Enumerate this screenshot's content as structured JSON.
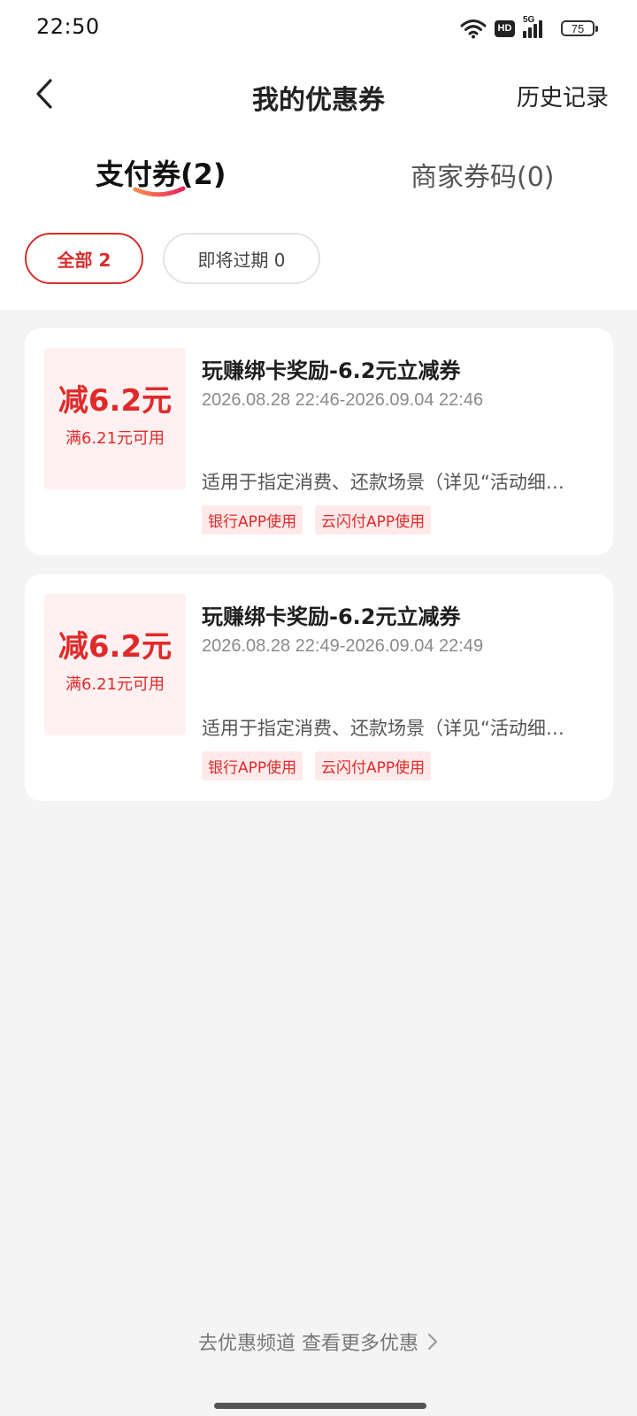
{
  "status_bar": {
    "time": "22:50",
    "hd_label": "HD",
    "network_label": "5G",
    "battery": "75"
  },
  "header": {
    "title": "我的优惠券",
    "history_label": "历史记录"
  },
  "tabs": [
    {
      "label": "支付券(2)",
      "active": true
    },
    {
      "label": "商家券码(0)",
      "active": false
    }
  ],
  "filters": [
    {
      "label": "全部 2",
      "active": true
    },
    {
      "label": "即将过期 0",
      "active": false
    }
  ],
  "coupons": [
    {
      "amount": "减6.2元",
      "condition": "满6.21元可用",
      "title": "玩赚绑卡奖励-6.2元立减券",
      "period": "2026.08.28 22:46-2026.09.04 22:46",
      "description": "适用于指定消费、还款场景（详见“活动细则”）",
      "tags": [
        "银行APP使用",
        "云闪付APP使用"
      ]
    },
    {
      "amount": "减6.2元",
      "condition": "满6.21元可用",
      "title": "玩赚绑卡奖励-6.2元立减券",
      "period": "2026.08.28 22:49-2026.09.04 22:49",
      "description": "适用于指定消费、还款场景（详见“活动细则”）",
      "tags": [
        "银行APP使用",
        "云闪付APP使用"
      ]
    }
  ],
  "footer": {
    "more_link": "去优惠频道 查看更多优惠"
  },
  "colors": {
    "accent": "#e02a2a",
    "chip_border_active": "#d82d2d",
    "amount_bg": "#fff1f1",
    "tag_bg": "#ffeaea",
    "page_bg": "#f4f4f4"
  }
}
